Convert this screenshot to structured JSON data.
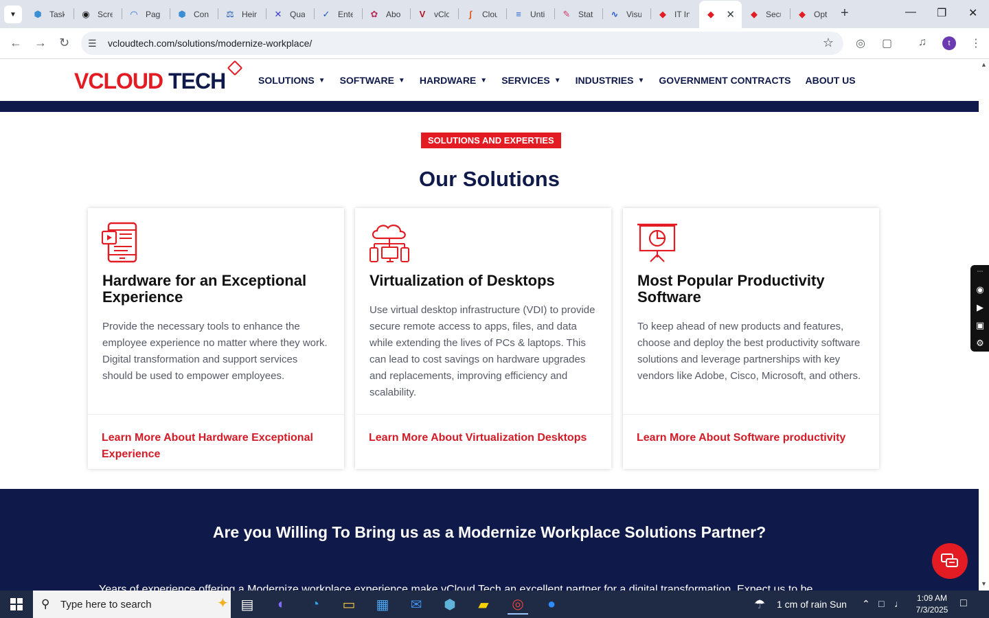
{
  "browser": {
    "tabs": [
      {
        "title": "Task",
        "icon": "hexagon-icon",
        "color": "#3a8fd4"
      },
      {
        "title": "Scre",
        "icon": "camera-icon",
        "color": "#1a1a1a"
      },
      {
        "title": "Page",
        "icon": "gauge-icon",
        "color": "#2a6bd6"
      },
      {
        "title": "Con",
        "icon": "hexagon-icon",
        "color": "#3a8fd4"
      },
      {
        "title": "Hein",
        "icon": "scale-icon",
        "color": "#1d56b4"
      },
      {
        "title": "Qua",
        "icon": "x-mark-icon",
        "color": "#3a3ad0"
      },
      {
        "title": "Ente",
        "icon": "check-icon",
        "color": "#1d56b4"
      },
      {
        "title": "Abo",
        "icon": "flower-icon",
        "color": "#b8325a"
      },
      {
        "title": "vClo",
        "icon": "v-logo-icon",
        "color": "#b01822"
      },
      {
        "title": "Clou",
        "icon": "swoosh-icon",
        "color": "#e05a1a"
      },
      {
        "title": "Unti",
        "icon": "document-icon",
        "color": "#2a6bd6"
      },
      {
        "title": "Stat",
        "icon": "pen-icon",
        "color": "#d4366e"
      },
      {
        "title": "Visu",
        "icon": "pulse-icon",
        "color": "#2a5bd6"
      },
      {
        "title": "IT In",
        "icon": "tag-icon",
        "color": "#e31b23"
      },
      {
        "title": "",
        "icon": "tag-icon",
        "color": "#e31b23"
      },
      {
        "title": "Secu",
        "icon": "tag-icon",
        "color": "#e31b23"
      },
      {
        "title": "Opt",
        "icon": "tag-icon",
        "color": "#e31b23"
      }
    ],
    "url": "vcloudtech.com/solutions/modernize-workplace/"
  },
  "site": {
    "logo": {
      "v": "V",
      "cloud": "CLOUD",
      "tech": "TECH"
    },
    "nav": [
      {
        "label": "SOLUTIONS",
        "has_caret": true
      },
      {
        "label": "SOFTWARE",
        "has_caret": true
      },
      {
        "label": "HARDWARE",
        "has_caret": true
      },
      {
        "label": "SERVICES",
        "has_caret": true
      },
      {
        "label": "INDUSTRIES",
        "has_caret": true
      },
      {
        "label": "GOVERNMENT CONTRACTS",
        "has_caret": false
      },
      {
        "label": "ABOUT US",
        "has_caret": false
      }
    ],
    "badge": "SOLUTIONS AND EXPERTIES",
    "section_title": "Our Solutions",
    "cards": [
      {
        "icon": "tablet-video-icon",
        "title": "Hardware for an Exceptional Experience",
        "body": "Provide the necessary tools to enhance the employee experience no matter where they work. Digital transformation and support services should be used to empower employees.",
        "link": "Learn More About Hardware Exceptional Experience"
      },
      {
        "icon": "cloud-devices-icon",
        "title": "Virtualization of Desktops",
        "body": "Use virtual desktop infrastructure (VDI) to provide secure remote access to apps, files, and data while extending the lives of PCs & laptops. This can lead to cost savings on hardware upgrades and replacements, improving efficiency and scalability.",
        "link": "Learn More About Virtualization Desktops"
      },
      {
        "icon": "presentation-chart-icon",
        "title": "Most Popular Productivity Software",
        "body": "To keep ahead of new products and features, choose and deploy the best productivity software solutions and leverage partnerships with key vendors like Adobe, Cisco, Microsoft, and others.",
        "link": "Learn More About Software productivity"
      }
    ],
    "cta_title": "Are you Willing To Bring us as a Modernize Workplace Solutions Partner?",
    "cta_body_cut": "Years of experience offering a Modernize workplace experience make vCloud Tech an excellent partner for a digital transformation. Expect us to be",
    "colors": {
      "brand_red": "#e31b23",
      "brand_navy": "#101a4a"
    }
  },
  "taskbar": {
    "search_placeholder": "Type here to search",
    "weather": "1 cm of rain Sun",
    "time": "1:09 AM",
    "date": "7/3/2025",
    "apps": [
      "task-view-icon",
      "copilot-icon",
      "edge-icon",
      "file-explorer-icon",
      "store-icon",
      "mail-icon",
      "hexagon-app-icon",
      "sticky-notes-icon",
      "chrome-icon",
      "zoom-icon"
    ]
  }
}
